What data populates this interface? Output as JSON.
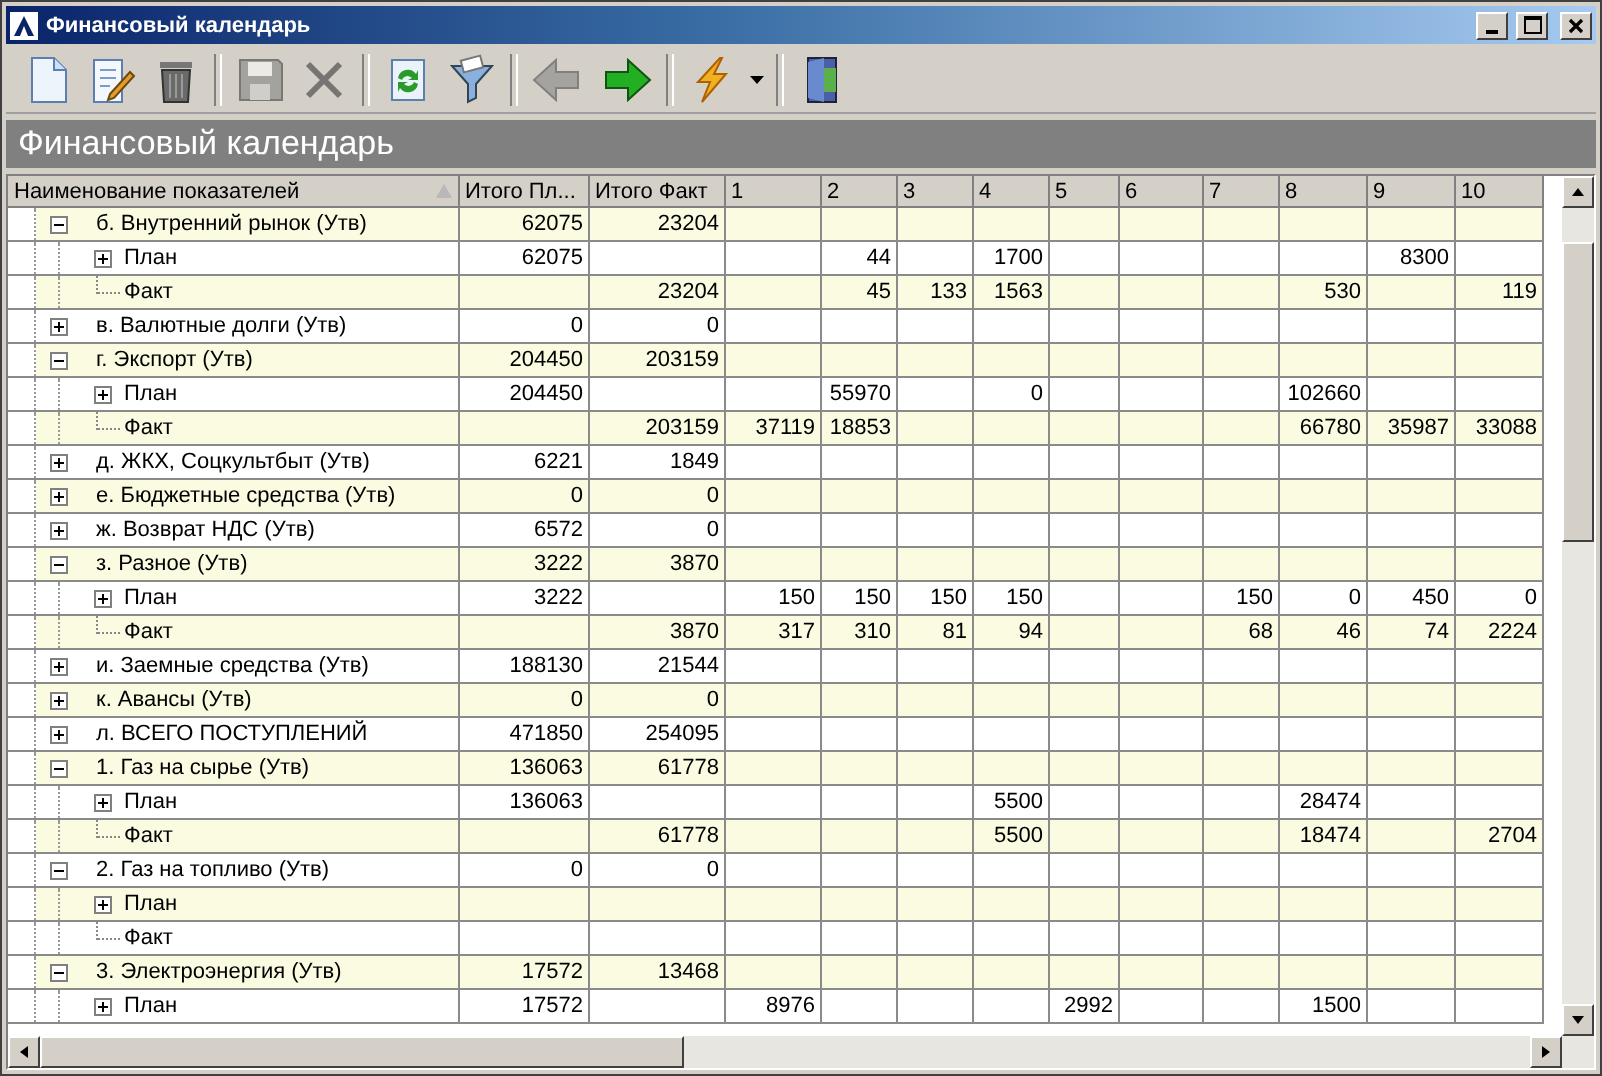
{
  "window": {
    "title": "Финансовый календарь"
  },
  "toolbar": [
    {
      "kind": "new",
      "disabled": false
    },
    {
      "kind": "edit",
      "disabled": false
    },
    {
      "kind": "delete",
      "disabled": false
    },
    {
      "kind": "sep"
    },
    {
      "kind": "save",
      "disabled": true
    },
    {
      "kind": "cancel",
      "disabled": true
    },
    {
      "kind": "sep"
    },
    {
      "kind": "refresh",
      "disabled": false
    },
    {
      "kind": "filter",
      "disabled": false
    },
    {
      "kind": "sep"
    },
    {
      "kind": "back",
      "disabled": true
    },
    {
      "kind": "forward",
      "disabled": false
    },
    {
      "kind": "sep"
    },
    {
      "kind": "action",
      "disabled": false
    },
    {
      "kind": "sep"
    },
    {
      "kind": "exit",
      "disabled": false
    }
  ],
  "banner": {
    "title": "Финансовый календарь"
  },
  "table": {
    "columns": [
      "Наименование показателей",
      "Итого Пл...",
      "Итого Факт",
      "1",
      "2",
      "3",
      "4",
      "5",
      "6",
      "7",
      "8",
      "9",
      "10"
    ],
    "rows": [
      {
        "label": "б. Внутренний рынок (Утв)",
        "expanded": true,
        "values": {
          "total_plan": "62075",
          "total_fact": "23204"
        },
        "children": [
          {
            "label": "План",
            "expanded": false,
            "values": {
              "total_plan": "62075",
              "day_2": "44",
              "day_4": "1700",
              "day_9": "8300"
            }
          },
          {
            "label": "Факт",
            "values": {
              "total_fact": "23204",
              "day_2": "45",
              "day_3": "133",
              "day_4": "1563",
              "day_8": "530",
              "day_10": "119"
            }
          }
        ]
      },
      {
        "label": "в. Валютные долги (Утв)",
        "expanded": false,
        "values": {
          "total_plan": "0",
          "total_fact": "0"
        }
      },
      {
        "label": "г. Экспорт (Утв)",
        "expanded": true,
        "values": {
          "total_plan": "204450",
          "total_fact": "203159"
        },
        "children": [
          {
            "label": "План",
            "expanded": false,
            "values": {
              "total_plan": "204450",
              "day_2": "55970",
              "day_4": "0",
              "day_8": "102660"
            }
          },
          {
            "label": "Факт",
            "values": {
              "total_fact": "203159",
              "day_1": "37119",
              "day_2": "18853",
              "day_8": "66780",
              "day_9": "35987",
              "day_10": "33088"
            }
          }
        ]
      },
      {
        "label": "д. ЖКХ, Соцкультбыт (Утв)",
        "expanded": false,
        "values": {
          "total_plan": "6221",
          "total_fact": "1849"
        }
      },
      {
        "label": "е. Бюджетные средства (Утв)",
        "expanded": false,
        "values": {
          "total_plan": "0",
          "total_fact": "0"
        }
      },
      {
        "label": "ж. Возврат НДС (Утв)",
        "expanded": false,
        "values": {
          "total_plan": "6572",
          "total_fact": "0"
        }
      },
      {
        "label": "з. Разное (Утв)",
        "expanded": true,
        "values": {
          "total_plan": "3222",
          "total_fact": "3870"
        },
        "children": [
          {
            "label": "План",
            "expanded": false,
            "values": {
              "total_plan": "3222",
              "day_1": "150",
              "day_2": "150",
              "day_3": "150",
              "day_4": "150",
              "day_7": "150",
              "day_8": "0",
              "day_9": "450",
              "day_10": "0"
            }
          },
          {
            "label": "Факт",
            "values": {
              "total_fact": "3870",
              "day_1": "317",
              "day_2": "310",
              "day_3": "81",
              "day_4": "94",
              "day_7": "68",
              "day_8": "46",
              "day_9": "74",
              "day_10": "2224"
            }
          }
        ]
      },
      {
        "label": "и. Заемные средства (Утв)",
        "expanded": false,
        "values": {
          "total_plan": "188130",
          "total_fact": "21544"
        }
      },
      {
        "label": "к. Авансы (Утв)",
        "expanded": false,
        "values": {
          "total_plan": "0",
          "total_fact": "0"
        }
      },
      {
        "label": "л. ВСЕГО ПОСТУПЛЕНИЙ",
        "expanded": false,
        "values": {
          "total_plan": "471850",
          "total_fact": "254095"
        }
      },
      {
        "label": "1. Газ на сырье (Утв)",
        "expanded": true,
        "values": {
          "total_plan": "136063",
          "total_fact": "61778"
        },
        "children": [
          {
            "label": "План",
            "expanded": false,
            "values": {
              "total_plan": "136063",
              "day_4": "5500",
              "day_8": "28474"
            }
          },
          {
            "label": "Факт",
            "values": {
              "total_fact": "61778",
              "day_4": "5500",
              "day_8": "18474",
              "day_10": "2704"
            }
          }
        ]
      },
      {
        "label": "2. Газ на топливо (Утв)",
        "expanded": true,
        "values": {
          "total_plan": "0",
          "total_fact": "0"
        },
        "children": [
          {
            "label": "План",
            "expanded": false
          },
          {
            "label": "Факт"
          }
        ]
      },
      {
        "label": "3. Электроэнергия (Утв)",
        "expanded": true,
        "values": {
          "total_plan": "17572",
          "total_fact": "13468"
        },
        "children": [
          {
            "label": "План",
            "expanded": false,
            "values": {
              "total_plan": "17572",
              "day_1": "8976",
              "day_5": "2992",
              "day_8": "1500"
            }
          }
        ]
      }
    ]
  }
}
